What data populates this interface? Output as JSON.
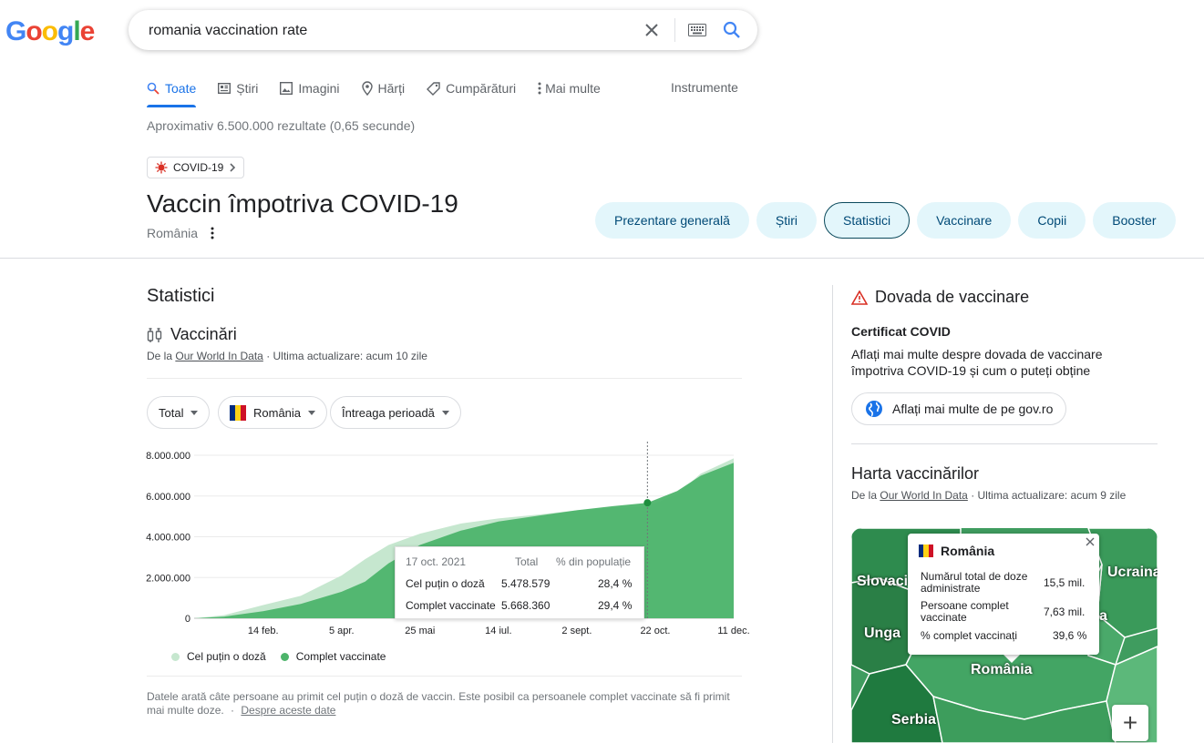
{
  "logo": {
    "letters": [
      "G",
      "o",
      "o",
      "g",
      "l",
      "e"
    ],
    "colors": [
      "#4285F4",
      "#EA4335",
      "#FBBC05",
      "#4285F4",
      "#34A853",
      "#EA4335"
    ]
  },
  "search": {
    "query": "romania vaccination rate"
  },
  "tabs": [
    {
      "label": "Toate",
      "icon": "search-icon",
      "active": true
    },
    {
      "label": "Știri",
      "icon": "news-icon"
    },
    {
      "label": "Imagini",
      "icon": "image-icon"
    },
    {
      "label": "Hărți",
      "icon": "map-pin-icon"
    },
    {
      "label": "Cumpărături",
      "icon": "tag-icon"
    },
    {
      "label": "Mai multe",
      "icon": "more-vert-icon"
    }
  ],
  "tools_label": "Instrumente",
  "result_stats": "Aproximativ 6.500.000 rezultate (0,65 secunde)",
  "topic_chip": "COVID-19",
  "topic": {
    "title": "Vaccin împotriva COVID-19",
    "subtitle": "România"
  },
  "pills": [
    "Prezentare generală",
    "Știri",
    "Statistici",
    "Vaccinare",
    "Copii",
    "Booster"
  ],
  "active_pill": "Statistici",
  "stats_section": {
    "title": "Statistici",
    "vacc_title": "Vaccinări",
    "source_prefix": "De la",
    "source_link": "Our World In Data",
    "source_suffix": "· Ultima actualizare: acum 10 zile",
    "filters": {
      "total": "Total",
      "country": "România",
      "period": "Întreaga perioadă"
    },
    "note": "Datele arată câte persoane au primit cel puțin o doză de vaccin. Este posibil ca persoanele complet vaccinate să fi primit mai multe doze.",
    "note_sep": "·",
    "note_link": "Despre aceste date"
  },
  "chart_data": {
    "type": "area",
    "x": [
      "2021-01-01",
      "2021-01-20",
      "2021-02-14",
      "2021-03-10",
      "2021-04-05",
      "2021-04-20",
      "2021-05-05",
      "2021-05-25",
      "2021-06-20",
      "2021-07-14",
      "2021-08-10",
      "2021-09-02",
      "2021-09-25",
      "2021-10-17",
      "2021-11-05",
      "2021-11-20",
      "2021-12-11"
    ],
    "x_tick_labels": [
      "14 feb.",
      "5 apr.",
      "25 mai",
      "14 iul.",
      "2 sept.",
      "22 oct.",
      "11 dec."
    ],
    "x_ticks": [
      "2021-02-14",
      "2021-04-05",
      "2021-05-25",
      "2021-07-14",
      "2021-09-02",
      "2021-10-22",
      "2021-12-11"
    ],
    "y_tick_labels": [
      "0",
      "2.000.000",
      "4.000.000",
      "6.000.000",
      "8.000.000"
    ],
    "y_ticks": [
      0,
      2000000,
      4000000,
      6000000,
      8000000
    ],
    "ylim": [
      0,
      8000000
    ],
    "series": [
      {
        "name": "Cel puțin o doză",
        "color": "#c6e7cf",
        "values": [
          0,
          150000,
          650000,
          1100000,
          2100000,
          2900000,
          3600000,
          4150000,
          4650000,
          4900000,
          5100000,
          5300000,
          5420000,
          5478579,
          6100000,
          7100000,
          7850000
        ]
      },
      {
        "name": "Complet vaccinate",
        "color": "#4db46b",
        "values": [
          0,
          80000,
          350000,
          700000,
          1300000,
          1800000,
          2700000,
          3600000,
          4300000,
          4750000,
          5050000,
          5300000,
          5500000,
          5668360,
          6250000,
          7000000,
          7630000
        ]
      }
    ],
    "grid": true,
    "legend": "bottom-left"
  },
  "chart_tooltip": {
    "date": "17 oct. 2021",
    "col_total": "Total",
    "col_pct": "% din populație",
    "rows": [
      {
        "label": "Cel puțin o doză",
        "total": "5.478.579",
        "pct": "28,4 %"
      },
      {
        "label": "Complet vaccinate",
        "total": "5.668.360",
        "pct": "29,4 %"
      }
    ]
  },
  "right_panel": {
    "dovada_title": "Dovada de vaccinare",
    "cert_title": "Certificat COVID",
    "cert_desc": "Aflați mai multe despre dovada de vaccinare împotriva COVID-19 și cum o puteți obține",
    "gov_button": "Aflați mai multe de pe gov.ro",
    "harta_title": "Harta vaccinărilor",
    "harta_source_prefix": "De la",
    "harta_source_link": "Our World In Data",
    "harta_source_suffix": "· Ultima actualizare: acum 9 zile",
    "map_labels": {
      "slovacia": "Slovaci",
      "ucraina": "Ucraina",
      "ungaria": "Unga",
      "romania": "România",
      "serbia": "Serbia",
      "moldova": "a"
    },
    "map_tooltip": {
      "country": "România",
      "rows": [
        {
          "label": "Numărul total de doze administrate",
          "value": "15,5 mil."
        },
        {
          "label": "Persoane complet vaccinate",
          "value": "7,63 mil."
        },
        {
          "label": "% complet vaccinați",
          "value": "39,6 %"
        }
      ]
    }
  }
}
